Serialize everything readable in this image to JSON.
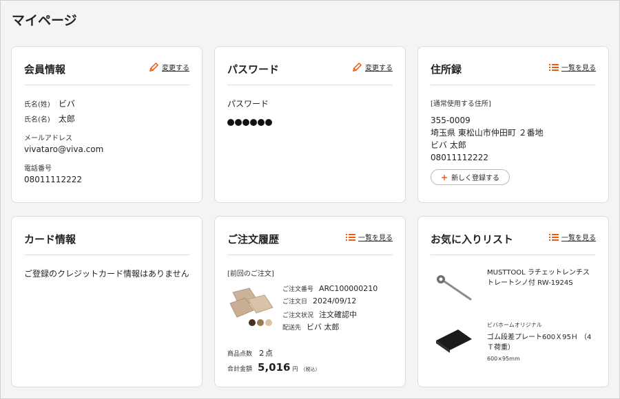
{
  "page": {
    "title": "マイページ"
  },
  "member": {
    "title": "会員情報",
    "action": "変更する",
    "last_name_label": "氏名(姓)",
    "last_name": "ビバ",
    "first_name_label": "氏名(名)",
    "first_name": "太郎",
    "email_label": "メールアドレス",
    "email": "vivataro@viva.com",
    "phone_label": "電話番号",
    "phone": "08011112222"
  },
  "password": {
    "title": "パスワード",
    "action": "変更する",
    "label": "パスワード",
    "mask_count": 6
  },
  "address": {
    "title": "住所録",
    "action": "一覧を見る",
    "default_label": "[通常使用する住所]",
    "postal": "355-0009",
    "street": "埼玉県 東松山市仲田町 ２番地",
    "name": "ビバ 太郎",
    "phone": "08011112222",
    "register_button": "新しく登録する"
  },
  "card": {
    "title": "カード情報",
    "empty_message": "ご登録のクレジットカード情報はありません"
  },
  "orders": {
    "title": "ご注文履歴",
    "action": "一覧を見る",
    "previous_label": "[前回のご注文]",
    "order_no_label": "ご注文番号",
    "order_no": "ARC100000210",
    "order_date_label": "ご注文日",
    "order_date": "2024/09/12",
    "status_label": "ご注文状況",
    "status": "注文確認中",
    "ship_to_label": "配送先",
    "ship_to": "ビバ 太郎",
    "item_count_label": "商品点数",
    "item_count": "２点",
    "total_label": "合計金額",
    "total": "5,016",
    "total_unit": "円",
    "tax_note": "（税込）"
  },
  "favorites": {
    "title": "お気に入りリスト",
    "action": "一覧を見る",
    "items": [
      {
        "brand": "",
        "name": "MUSTTOOL ラチェットレンチストレートシノ付 RW-1924S",
        "spec": ""
      },
      {
        "brand": "ビバホームオリジナル",
        "name": "ゴム段差プレート600Ｘ95Ｈ （4Ｔ荷重）",
        "spec": "600×95mm"
      }
    ]
  },
  "colors": {
    "accent": "#e85a0c",
    "border": "#dcdcdc",
    "background": "#f4f4f4"
  }
}
